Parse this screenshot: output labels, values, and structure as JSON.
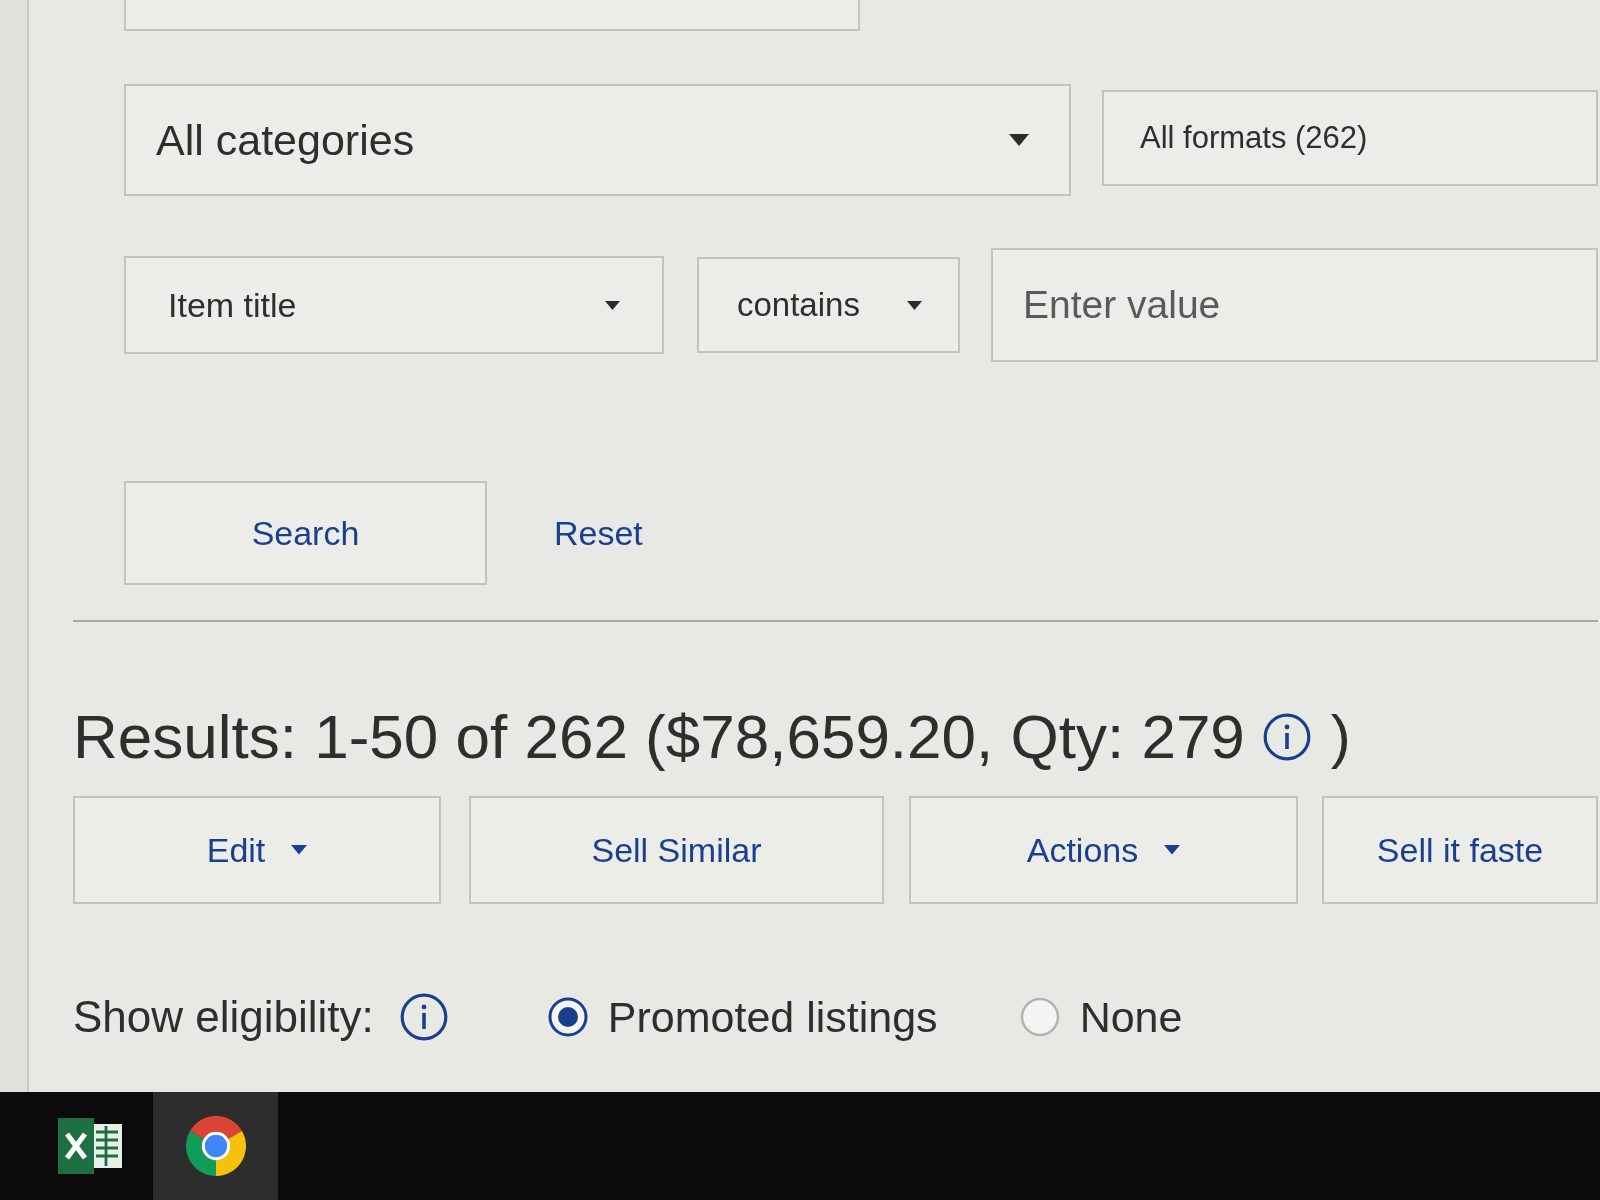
{
  "filters": {
    "category": {
      "value": "All categories"
    },
    "format": {
      "value": "All formats (262)"
    },
    "field": {
      "value": "Item title"
    },
    "operator": {
      "value": "contains"
    },
    "search_value": {
      "placeholder": "Enter value"
    }
  },
  "form_buttons": {
    "search": "Search",
    "reset": "Reset"
  },
  "results": {
    "summary": "Results: 1-50 of 262 ($78,659.20, Qty: 279",
    "closing": ")"
  },
  "actions": [
    {
      "label": "Edit",
      "kind": "dropdown"
    },
    {
      "label": "Sell Similar",
      "kind": "button"
    },
    {
      "label": "Actions",
      "kind": "dropdown"
    },
    {
      "label": "Sell it faste",
      "kind": "button"
    }
  ],
  "eligibility": {
    "label": "Show eligibility:",
    "options": [
      {
        "label": "Promoted listings",
        "selected": true
      },
      {
        "label": "None",
        "selected": false
      }
    ]
  },
  "taskbar": {
    "apps": [
      {
        "kind": "spreadsheet",
        "active": false
      },
      {
        "kind": "browser",
        "active": true
      }
    ]
  }
}
